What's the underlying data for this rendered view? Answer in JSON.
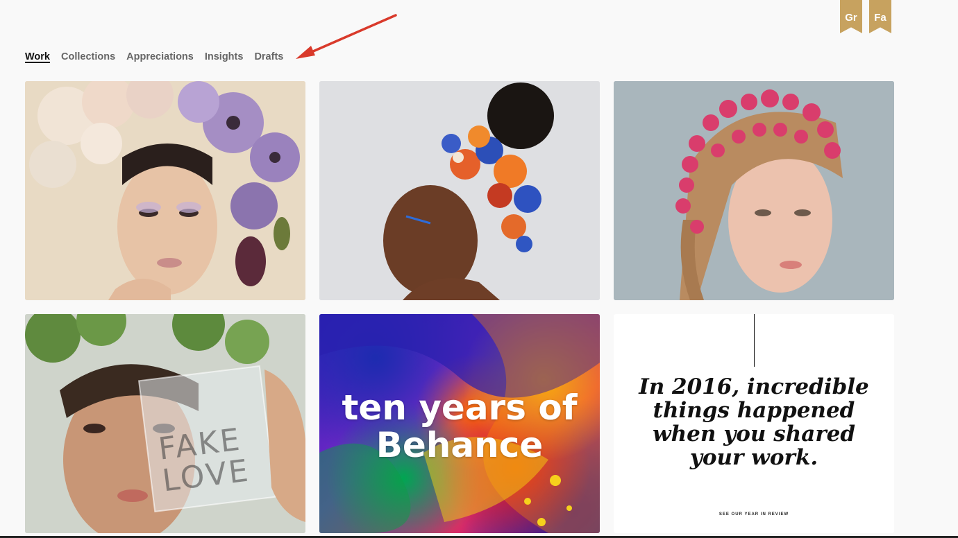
{
  "badges": [
    {
      "label": "Gr"
    },
    {
      "label": "Fa"
    }
  ],
  "tabs": [
    {
      "label": "Work",
      "active": true
    },
    {
      "label": "Collections",
      "active": false
    },
    {
      "label": "Appreciations",
      "active": false
    },
    {
      "label": "Insights",
      "active": false
    },
    {
      "label": "Drafts",
      "active": false
    }
  ],
  "colors": {
    "badge": "#c7a25f",
    "annotation_arrow": "#d93a2b",
    "background": "#f9f9f9"
  },
  "cards": [
    {
      "id": "portrait-floral-lavender"
    },
    {
      "id": "portrait-floral-orange-blue"
    },
    {
      "id": "portrait-floral-pink"
    },
    {
      "id": "portrait-fake-love",
      "text_lines": [
        "FAKE",
        "LOVE"
      ]
    },
    {
      "id": "behance-ten-years",
      "text_lines": [
        "ten years of",
        "Behance"
      ]
    },
    {
      "id": "year-in-review",
      "headline_lines": [
        "In 2016, incredible",
        "things happened",
        "when you shared",
        "your work."
      ],
      "cta": "SEE OUR YEAR IN REVIEW"
    }
  ]
}
